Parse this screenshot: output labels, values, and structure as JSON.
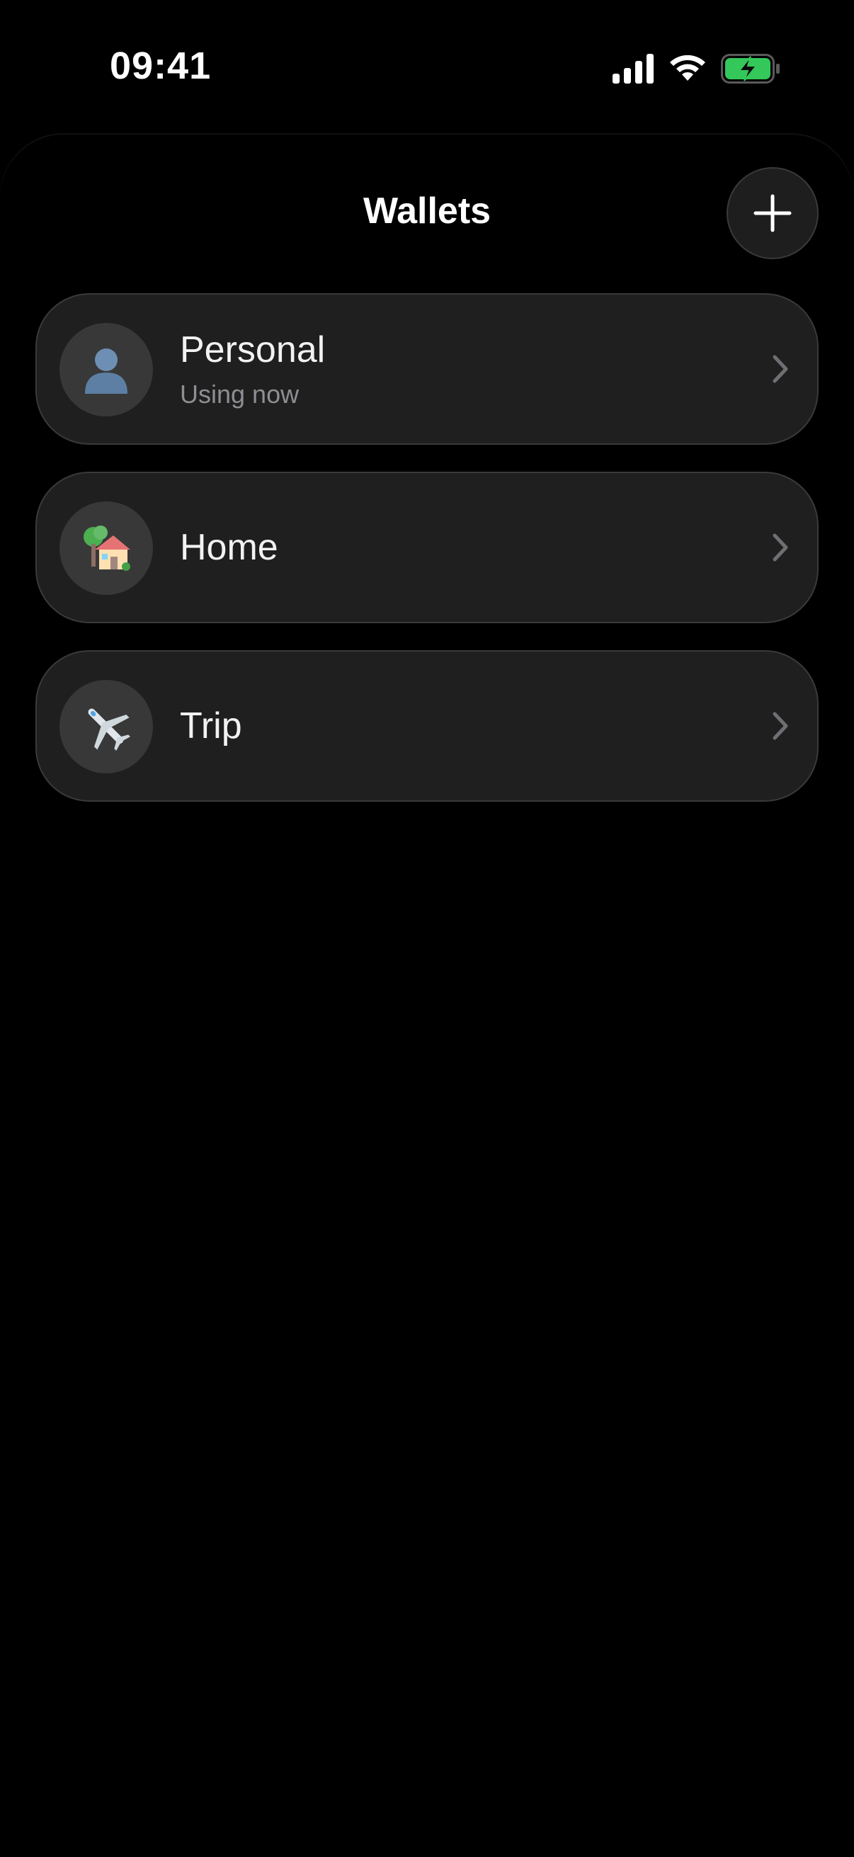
{
  "status_bar": {
    "time": "09:41",
    "icons": [
      "cellular-signal-icon",
      "wifi-icon",
      "battery-charging-icon"
    ],
    "battery_color": "#34c759"
  },
  "header": {
    "title": "Wallets",
    "add_icon": "plus-icon"
  },
  "wallets": [
    {
      "name": "Personal",
      "subtitle": "Using now",
      "icon": "person-silhouette-icon"
    },
    {
      "name": "Home",
      "subtitle": "",
      "icon": "house-with-tree-icon"
    },
    {
      "name": "Trip",
      "subtitle": "",
      "icon": "airplane-icon"
    }
  ],
  "colors": {
    "background": "#000000",
    "card": "#1f1f1f",
    "card_border": "#3a3a3a",
    "secondary_text": "#8e8e93"
  }
}
